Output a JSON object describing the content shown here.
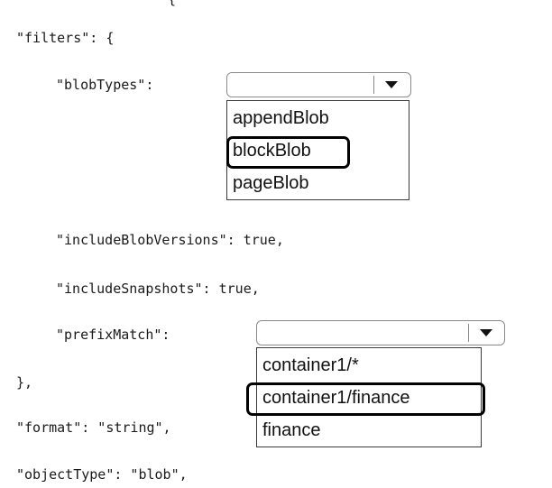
{
  "code": {
    "open_brace": "{",
    "filters_key": "\"filters\": {",
    "blobtypes_key": "\"blobTypes\":",
    "include_versions": "\"includeBlobVersions\": true,",
    "include_snapshots": "\"includeSnapshots\": true,",
    "prefixmatch_key": "\"prefixMatch\":",
    "close_filters": "},",
    "format": "\"format\": \"string\",",
    "object_type": "\"objectType\": \"blob\","
  },
  "blob_types_dropdown": {
    "selected": "",
    "options": [
      "appendBlob",
      "blockBlob",
      "pageBlob"
    ],
    "highlighted_option": "blockBlob"
  },
  "prefix_match_dropdown": {
    "selected": "",
    "options": [
      "container1/*",
      "container1/finance",
      "finance"
    ],
    "highlighted_option": "container1/finance"
  },
  "icons": {
    "dropdown_arrow": "caret-down-icon"
  }
}
